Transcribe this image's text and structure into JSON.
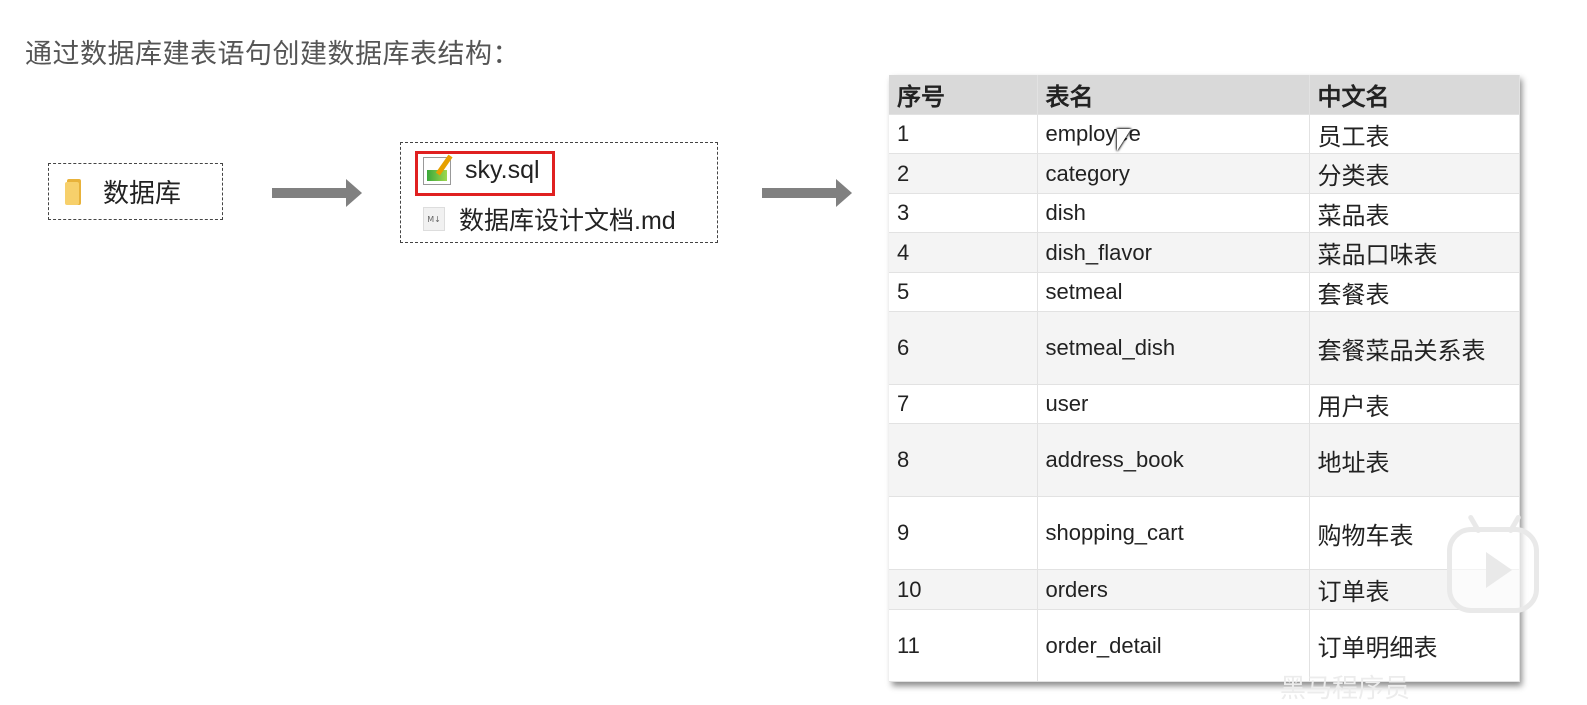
{
  "heading": "通过数据库建表语句创建数据库表结构：",
  "folder": {
    "label": "数据库",
    "icon": "folder-icon"
  },
  "files": [
    {
      "name": "sky.sql",
      "icon": "sql-file-icon",
      "highlighted": true
    },
    {
      "name": "数据库设计文档.md",
      "icon": "markdown-file-icon",
      "highlighted": false
    }
  ],
  "table": {
    "headers": [
      "序号",
      "表名",
      "中文名"
    ],
    "rows": [
      {
        "no": "1",
        "name": "employee",
        "cn": "员工表"
      },
      {
        "no": "2",
        "name": "category",
        "cn": "分类表"
      },
      {
        "no": "3",
        "name": "dish",
        "cn": "菜品表"
      },
      {
        "no": "4",
        "name": "dish_flavor",
        "cn": "菜品口味表"
      },
      {
        "no": "5",
        "name": "setmeal",
        "cn": "套餐表"
      },
      {
        "no": "6",
        "name": "setmeal_dish",
        "cn": "套餐菜品关系表"
      },
      {
        "no": "7",
        "name": "user",
        "cn": "用户表"
      },
      {
        "no": "8",
        "name": "address_book",
        "cn": "地址表"
      },
      {
        "no": "9",
        "name": "shopping_cart",
        "cn": "购物车表"
      },
      {
        "no": "10",
        "name": "orders",
        "cn": "订单表"
      },
      {
        "no": "11",
        "name": "order_detail",
        "cn": "订单明细表"
      }
    ]
  },
  "colors": {
    "highlight_border": "#e02020",
    "arrow": "#808080",
    "header_bg": "#d9d9d9",
    "folder": "#f7d06b"
  },
  "watermark": "黑马程序员"
}
